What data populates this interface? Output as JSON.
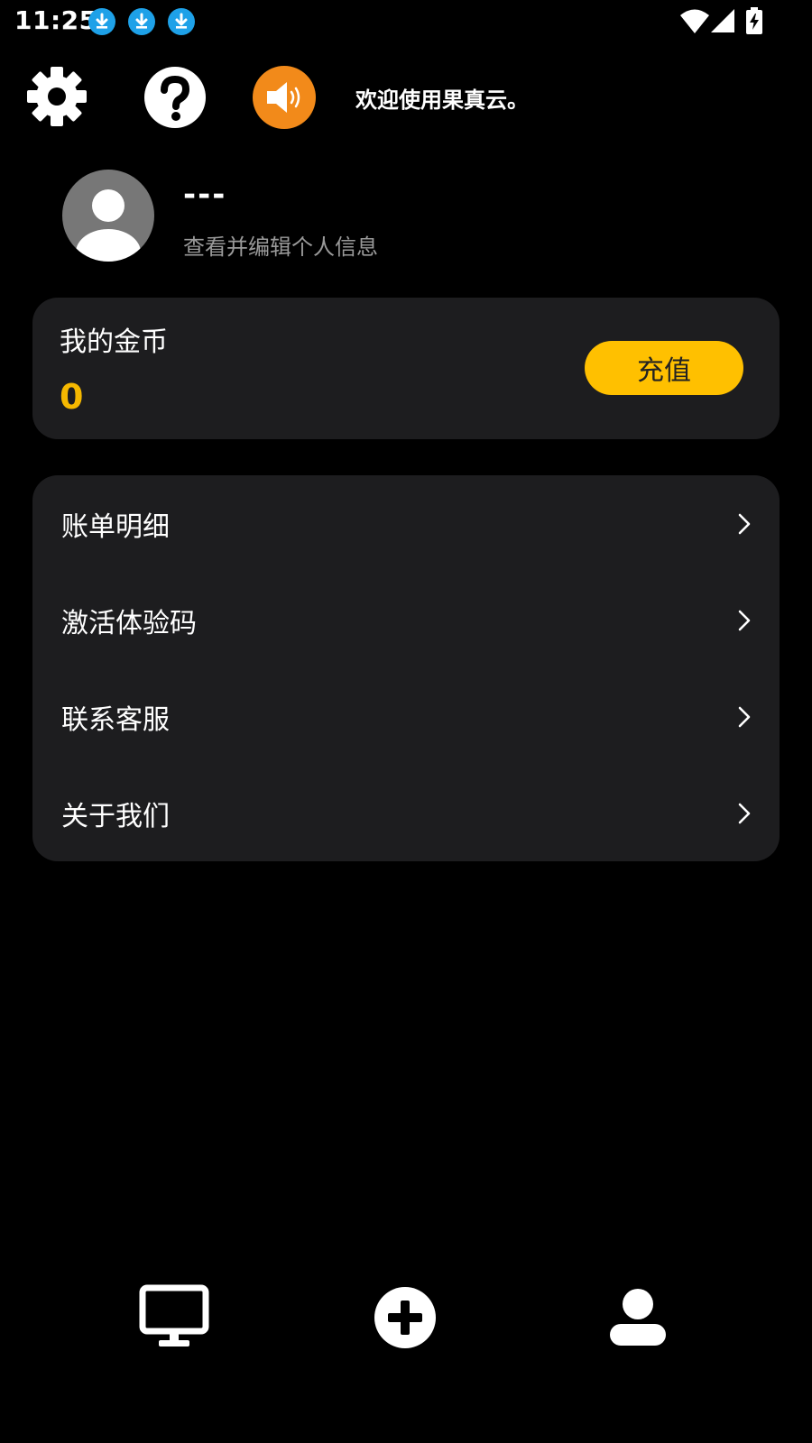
{
  "status_bar": {
    "time": "11:25",
    "notification_icons": [
      "download-icon",
      "download-icon",
      "download-icon"
    ],
    "system_icons": [
      "wifi-icon",
      "signal-icon",
      "battery-charging-icon"
    ]
  },
  "toolbar": {
    "icons": [
      "gear-icon",
      "help-icon",
      "announcement-icon"
    ],
    "welcome": "欢迎使用果真云。"
  },
  "profile": {
    "name": "---",
    "subtitle": "查看并编辑个人信息"
  },
  "coins": {
    "title": "我的金币",
    "value": "0",
    "recharge_label": "充值"
  },
  "menu": {
    "items": [
      {
        "label": "账单明细"
      },
      {
        "label": "激活体验码"
      },
      {
        "label": "联系客服"
      },
      {
        "label": "关于我们"
      }
    ]
  },
  "bottom_nav": {
    "icons": [
      "monitor-icon",
      "add-icon",
      "user-icon"
    ]
  },
  "colors": {
    "background": "#000000",
    "card": "#1d1d1f",
    "accent_yellow": "#ffc000",
    "coin_value": "#f5b800",
    "announce_orange": "#f28a1a",
    "download_blue": "#1ea1e8"
  }
}
